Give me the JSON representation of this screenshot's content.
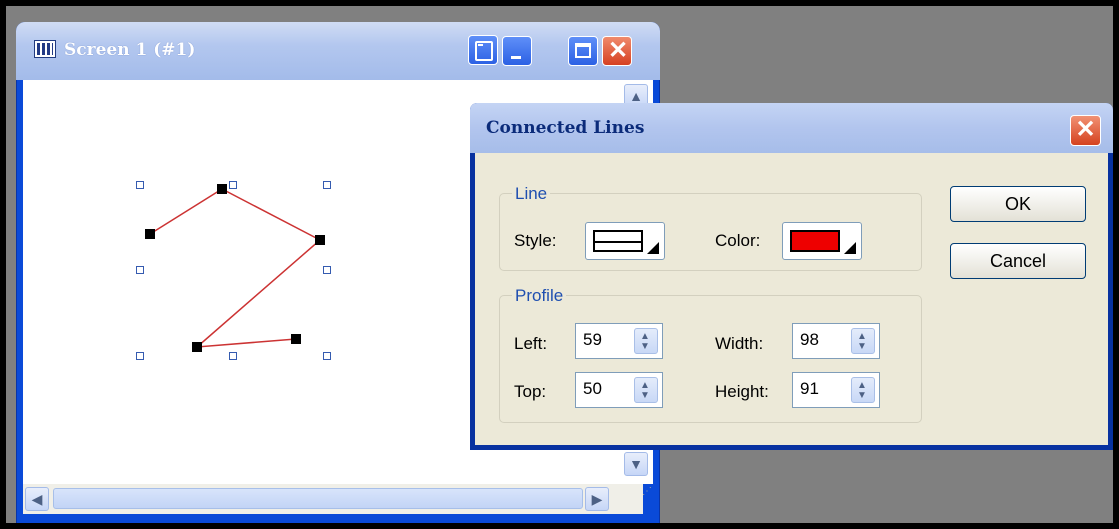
{
  "screen_window": {
    "title": "Screen 1 (#1)",
    "icons": {
      "app": "window-grid-icon",
      "restore": "restore-icon",
      "minimize": "minimize-icon",
      "maximize": "maximize-icon",
      "close": "close-icon",
      "scroll_up": "chevron-up-icon",
      "scroll_down": "chevron-down-icon",
      "scroll_left": "chevron-left-icon",
      "scroll_right": "chevron-right-icon"
    },
    "line_color": "#cc3333"
  },
  "dialog": {
    "title": "Connected Lines",
    "close_icon": "close-icon",
    "line_group": {
      "label": "Line",
      "style_label": "Style:",
      "color_label": "Color:",
      "color_value": "#ee0000"
    },
    "profile_group": {
      "label": "Profile",
      "left_label": "Left:",
      "left_value": "59",
      "top_label": "Top:",
      "top_value": "50",
      "width_label": "Width:",
      "width_value": "98",
      "height_label": "Height:",
      "height_value": "91"
    },
    "ok_label": "OK",
    "cancel_label": "Cancel"
  }
}
